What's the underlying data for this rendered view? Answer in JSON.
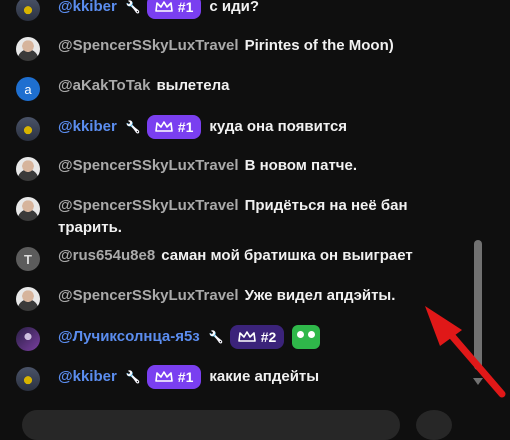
{
  "messages": [
    {
      "author": "@kkiber",
      "style": "kkiber",
      "mod": true,
      "badge": "#1",
      "badge_dark": false,
      "text": "с иди?"
    },
    {
      "author": "@SpencerSSkyLuxTravel",
      "style": "spencer",
      "text": "Pirintes of the Moon)"
    },
    {
      "author": "@aKakToTak",
      "style": "a",
      "avatar_letter": "a",
      "text": "вылетела"
    },
    {
      "author": "@kkiber",
      "style": "kkiber",
      "mod": true,
      "badge": "#1",
      "badge_dark": false,
      "text": "куда она появится"
    },
    {
      "author": "@SpencerSSkyLuxTravel",
      "style": "spencer",
      "text": "В новом патче."
    },
    {
      "author": "@SpencerSSkyLuxTravel",
      "style": "spencer",
      "text": "Придёться на неё бан трарить."
    },
    {
      "author": "@rus654u8e8",
      "style": "rus",
      "avatar_letter": "T",
      "text": "саман мой братишка он выиграет"
    },
    {
      "author": "@SpencerSSkyLuxTravel",
      "style": "spencer",
      "text": "Уже видел апдэйты."
    },
    {
      "author": "@Лучиксолнца-я5з",
      "style": "luchik",
      "mod": true,
      "badge": "#2",
      "badge_dark": true,
      "emote": "green-frog-emote",
      "text": ""
    },
    {
      "author": "@kkiber",
      "style": "kkiber",
      "mod": true,
      "badge": "#1",
      "badge_dark": false,
      "text": "какие апдейты"
    }
  ],
  "colors": {
    "background": "#0f0f0f",
    "moderator_name": "#5b8def",
    "badge": "#7a3ff0",
    "annotation_arrow": "#e01818"
  }
}
